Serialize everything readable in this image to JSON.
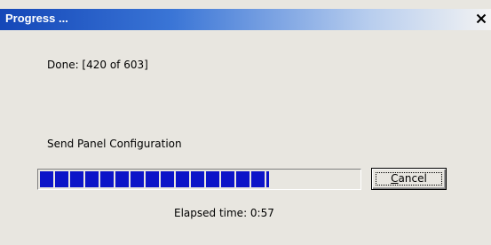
{
  "window": {
    "title": "Progress ...",
    "close_icon": "close-icon"
  },
  "status": {
    "done_text": "Done: [420 of 603]",
    "step_text": "Send Panel Configuration",
    "elapsed_text": "Elapsed time: 0:57"
  },
  "progress": {
    "fraction": 0.72
  },
  "buttons": {
    "cancel_mnemonic": "C",
    "cancel_rest": "ancel"
  },
  "colors": {
    "title_bar_start": "#1447b8",
    "progress_fill": "#0c14c8",
    "dialog_background": "#e8e6e0"
  }
}
